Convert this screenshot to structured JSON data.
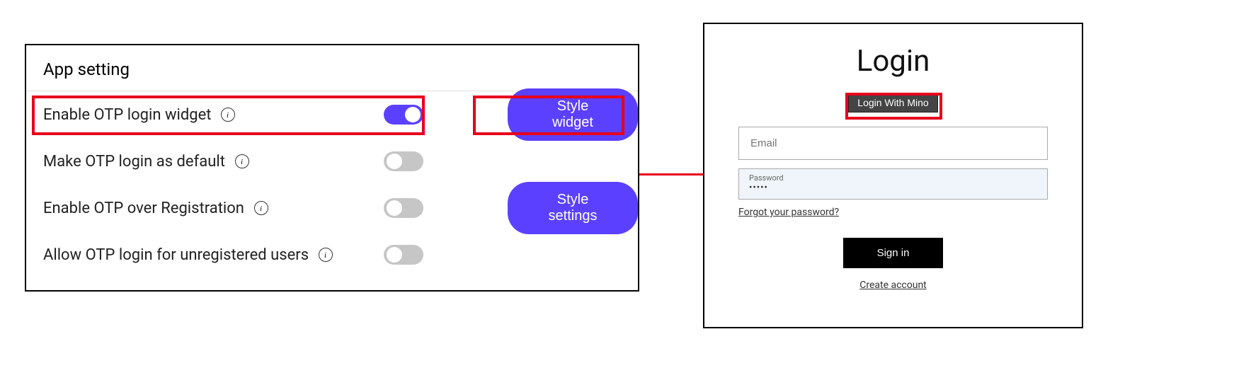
{
  "settings": {
    "title": "App setting",
    "rows": [
      {
        "label": "Enable OTP login widget",
        "enabled": true,
        "button": "Style widget"
      },
      {
        "label": "Make OTP login as default",
        "enabled": false,
        "button": null
      },
      {
        "label": "Enable OTP over Registration",
        "enabled": false,
        "button": "Style settings"
      },
      {
        "label": "Allow OTP login for unregistered users",
        "enabled": false,
        "button": null
      }
    ]
  },
  "login": {
    "title": "Login",
    "mino_button": "Login With Mino",
    "email_placeholder": "Email",
    "password_label": "Password",
    "password_value": "•••••",
    "forgot_link": "Forgot your password?",
    "signin_button": "Sign in",
    "create_account": "Create account"
  },
  "colors": {
    "accent": "#5B41FF",
    "highlight": "#e8001c"
  }
}
